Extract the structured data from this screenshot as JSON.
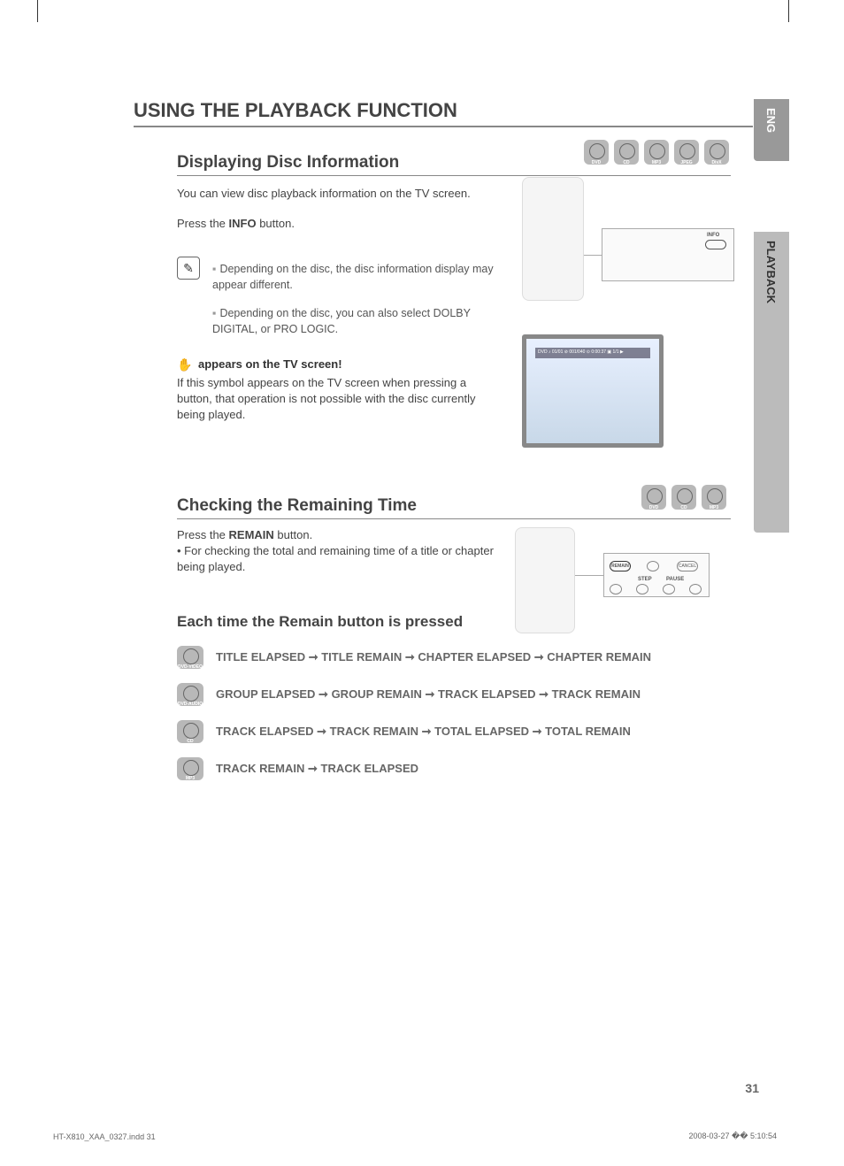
{
  "page_title": "USING THE PLAYBACK FUNCTION",
  "tabs": {
    "lang": "ENG",
    "section": "PLAYBACK"
  },
  "section1": {
    "heading": "Displaying Disc Information",
    "intro": "You can view disc playback information  on the TV screen.",
    "press_prefix": "Press the ",
    "press_bold": "INFO",
    "press_suffix": " button.",
    "note1": "Depending on the disc, the disc information display may appear different.",
    "note2": "Depending on the disc, you can also select DOLBY DIGITAL, or PRO LOGIC.",
    "tv_heading": "appears on the TV screen!",
    "tv_body": "If this symbol appears on the TV screen when pressing a button, that operation is not possible with the disc currently being played.",
    "badges": [
      "DVD",
      "CD",
      "MP3",
      "JPEG",
      "DivX"
    ],
    "callout_label": "INFO",
    "tv_overlay": "DVD ♪ 01/01 ⊘ 001/040 ⊙ 0:00:37  ▣ 1/1 ▶"
  },
  "section2": {
    "heading": "Checking the Remaining Time",
    "press_prefix": "Press the ",
    "press_bold": "REMAIN",
    "press_suffix": " button.",
    "bullet": "• For checking the total and remaining time of a title or chapter being played.",
    "badges": [
      "DVD",
      "CD",
      "MP3"
    ],
    "callout_buttons": {
      "remain": "REMAIN",
      "cancel": "CANCEL",
      "step": "STEP",
      "pause": "PAUSE"
    }
  },
  "section3": {
    "heading": "Each time the Remain button is pressed",
    "rows": [
      {
        "badge": "DVD-VIDEO",
        "text": "TITLE ELAPSED ➞ TITLE REMAIN ➞ CHAPTER ELAPSED ➞ CHAPTER REMAIN"
      },
      {
        "badge": "DVD-AUDIO",
        "text": "GROUP ELAPSED ➞ GROUP REMAIN ➞ TRACK ELAPSED ➞ TRACK REMAIN"
      },
      {
        "badge": "CD",
        "text": "TRACK ELAPSED ➞ TRACK REMAIN ➞ TOTAL ELAPSED ➞ TOTAL REMAIN"
      },
      {
        "badge": "MP3",
        "text": "TRACK REMAIN ➞ TRACK ELAPSED"
      }
    ]
  },
  "page_number": "31",
  "footer": {
    "left": "HT-X810_XAA_0327.indd   31",
    "right": "2008-03-27   �� 5:10:54"
  }
}
